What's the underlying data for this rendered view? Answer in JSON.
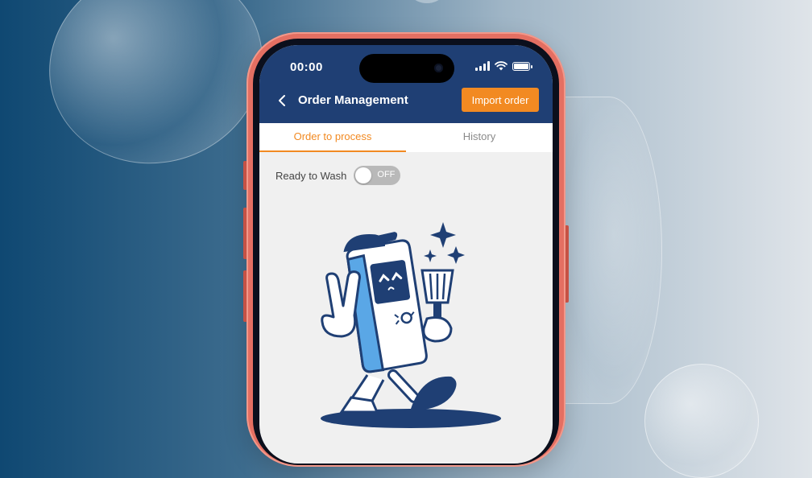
{
  "status_bar": {
    "time": "00:00",
    "icons": [
      "signal-icon",
      "wifi-icon",
      "battery-icon"
    ]
  },
  "header": {
    "back_icon": "chevron-left-icon",
    "title": "Order Management",
    "import_button_label": "Import order"
  },
  "tabs": [
    {
      "label": "Order to process",
      "active": true
    },
    {
      "label": "History",
      "active": false
    }
  ],
  "filter": {
    "label": "Ready to Wash",
    "toggle_state_text": "OFF",
    "toggle_on": false
  },
  "empty_state": {
    "illustration": "washing-machine-mascot-with-brush"
  },
  "colors": {
    "header_bg": "#1f3f74",
    "accent": "#f28a22",
    "phone_frame": "#e46f62",
    "screen_bg": "#f0f0f0",
    "toggle_off": "#b9b9b9"
  }
}
